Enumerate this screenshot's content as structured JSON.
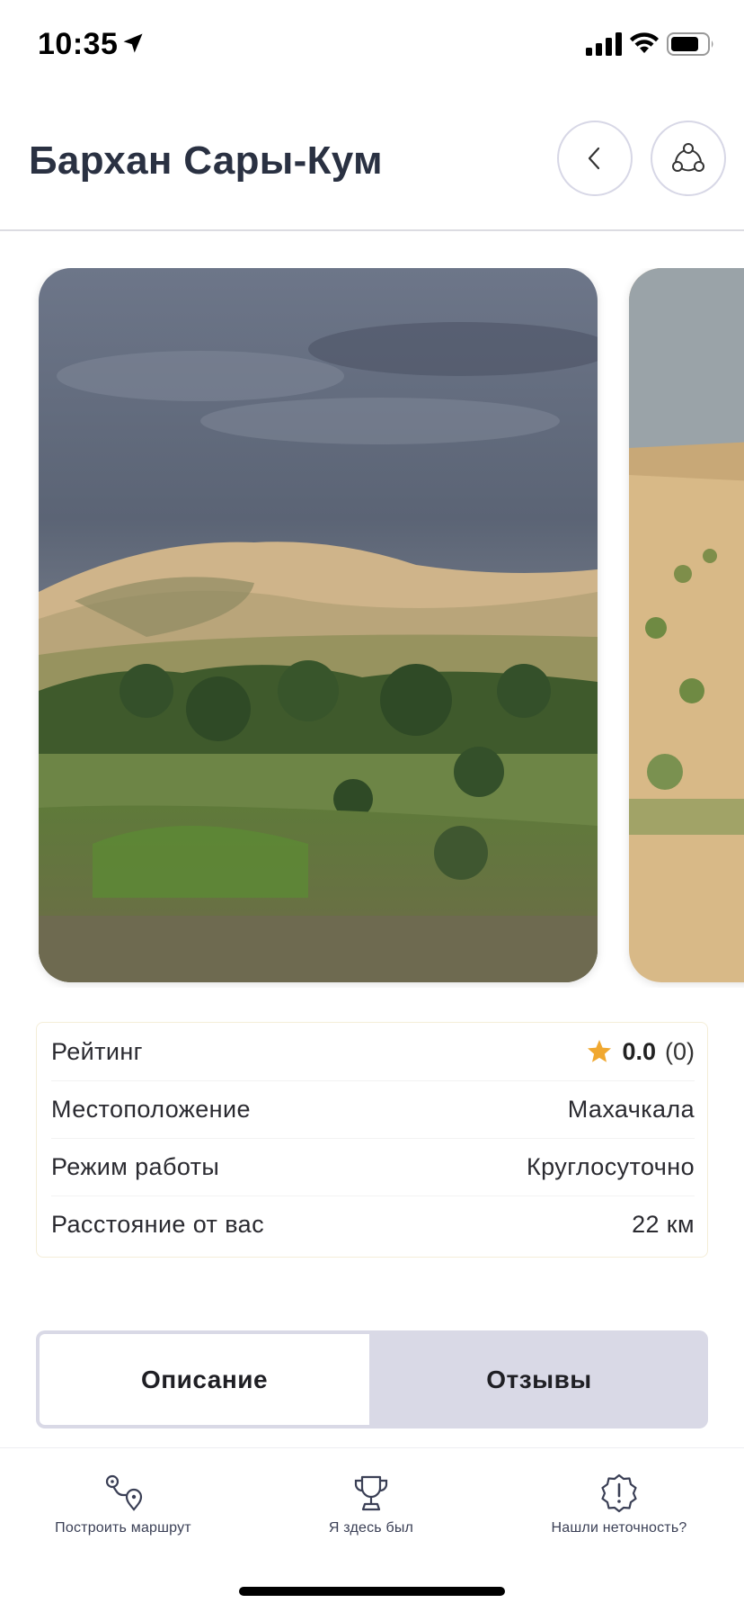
{
  "status_bar": {
    "time": "10:35",
    "icons": [
      "location-arrow-icon",
      "cellular-signal-icon",
      "wifi-icon",
      "battery-icon"
    ]
  },
  "header": {
    "title": "Бархан Сары-Кум",
    "back_icon": "chevron-left-icon",
    "share_icon": "share-icon"
  },
  "gallery": {
    "photos": [
      "sand-dune-photo",
      "sand-dune-close-photo"
    ]
  },
  "info": {
    "rating": {
      "label": "Рейтинг",
      "score": "0.0",
      "count": "(0)",
      "icon": "star-icon"
    },
    "location": {
      "label": "Местоположение",
      "value": "Махачкала"
    },
    "hours": {
      "label": "Режим работы",
      "value": "Круглосуточно"
    },
    "distance": {
      "label": "Расстояние от вас",
      "value": "22 км"
    }
  },
  "tabs": [
    {
      "label": "Описание",
      "active": true
    },
    {
      "label": "Отзывы",
      "active": false
    }
  ],
  "bottom_bar": [
    {
      "label": "Построить маршрут",
      "icon": "route-icon"
    },
    {
      "label": "Я здесь был",
      "icon": "trophy-icon"
    },
    {
      "label": "Нашли неточность?",
      "icon": "alert-badge-icon"
    }
  ],
  "colors": {
    "title": "#2a3142",
    "accent_star": "#f0a830",
    "tab_inactive_bg": "#d9d9e6",
    "border_soft": "#d7d7e6"
  }
}
